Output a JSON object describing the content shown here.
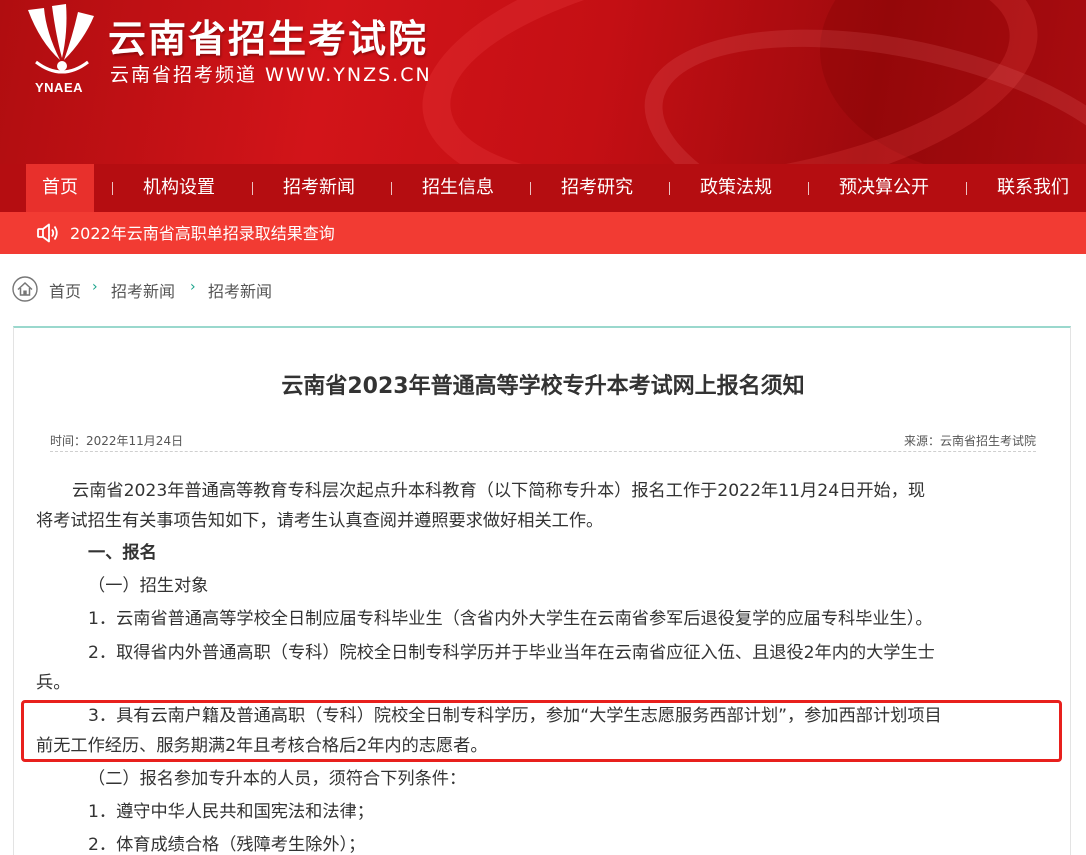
{
  "header": {
    "logo_text": "YNAEA",
    "title": "云南省招生考试院",
    "subtitle": "云南省招考频道 WWW.YNZS.CN"
  },
  "nav": {
    "items": [
      {
        "label": "首页",
        "active": true
      },
      {
        "label": "机构设置"
      },
      {
        "label": "招考新闻"
      },
      {
        "label": "招生信息"
      },
      {
        "label": "招考研究"
      },
      {
        "label": "政策法规"
      },
      {
        "label": "预决算公开"
      },
      {
        "label": "联系我们"
      }
    ]
  },
  "notice": {
    "icon": "speaker-icon",
    "text": "2022年云南省高职单招录取结果查询"
  },
  "breadcrumb": {
    "icon": "home-icon",
    "items": [
      "首页",
      "招考新闻",
      "招考新闻"
    ]
  },
  "article": {
    "title": "云南省2023年普通高等学校专升本考试网上报名须知",
    "date": "时间：2022年11月24日",
    "source": "来源：云南省招生考试院",
    "paragraphs": {
      "intro_1": "云南省2023年普通高等教育专科层次起点升本科教育（以下简称专升本）报名工作于2022年11月24日开始，现",
      "intro_2": "将考试招生有关事项告知如下，请考生认真查阅并遵照要求做好相关工作。",
      "section_1": "一、报名",
      "sub_1": "（一）招生对象",
      "item_1": "1．云南省普通高等学校全日制应届专科毕业生（含省内外大学生在云南省参军后退役复学的应届专科毕业生）。",
      "item_2a": "2．取得省内外普通高职（专科）院校全日制专科学历并于毕业当年在云南省应征入伍、且退役2年内的大学生士",
      "item_2b": "兵。",
      "item_3a": "3．具有云南户籍及普通高职（专科）院校全日制专科学历，参加“大学生志愿服务西部计划”，参加西部计划项目",
      "item_3b": "前无工作经历、服务期满2年且考核合格后2年内的志愿者。",
      "sub_2": "（二）报名参加专升本的人员，须符合下列条件：",
      "cond_1": "1．遵守中华人民共和国宪法和法律；",
      "cond_2": "2．体育成绩合格（残障考生除外）；"
    }
  },
  "colors": {
    "banner_red": "#c40f14",
    "nav_red": "#b50d11",
    "active_tab": "#e8302c",
    "notice_red": "#f23b33",
    "accent_teal": "#19a38a",
    "highlight_border": "#e8201d"
  }
}
